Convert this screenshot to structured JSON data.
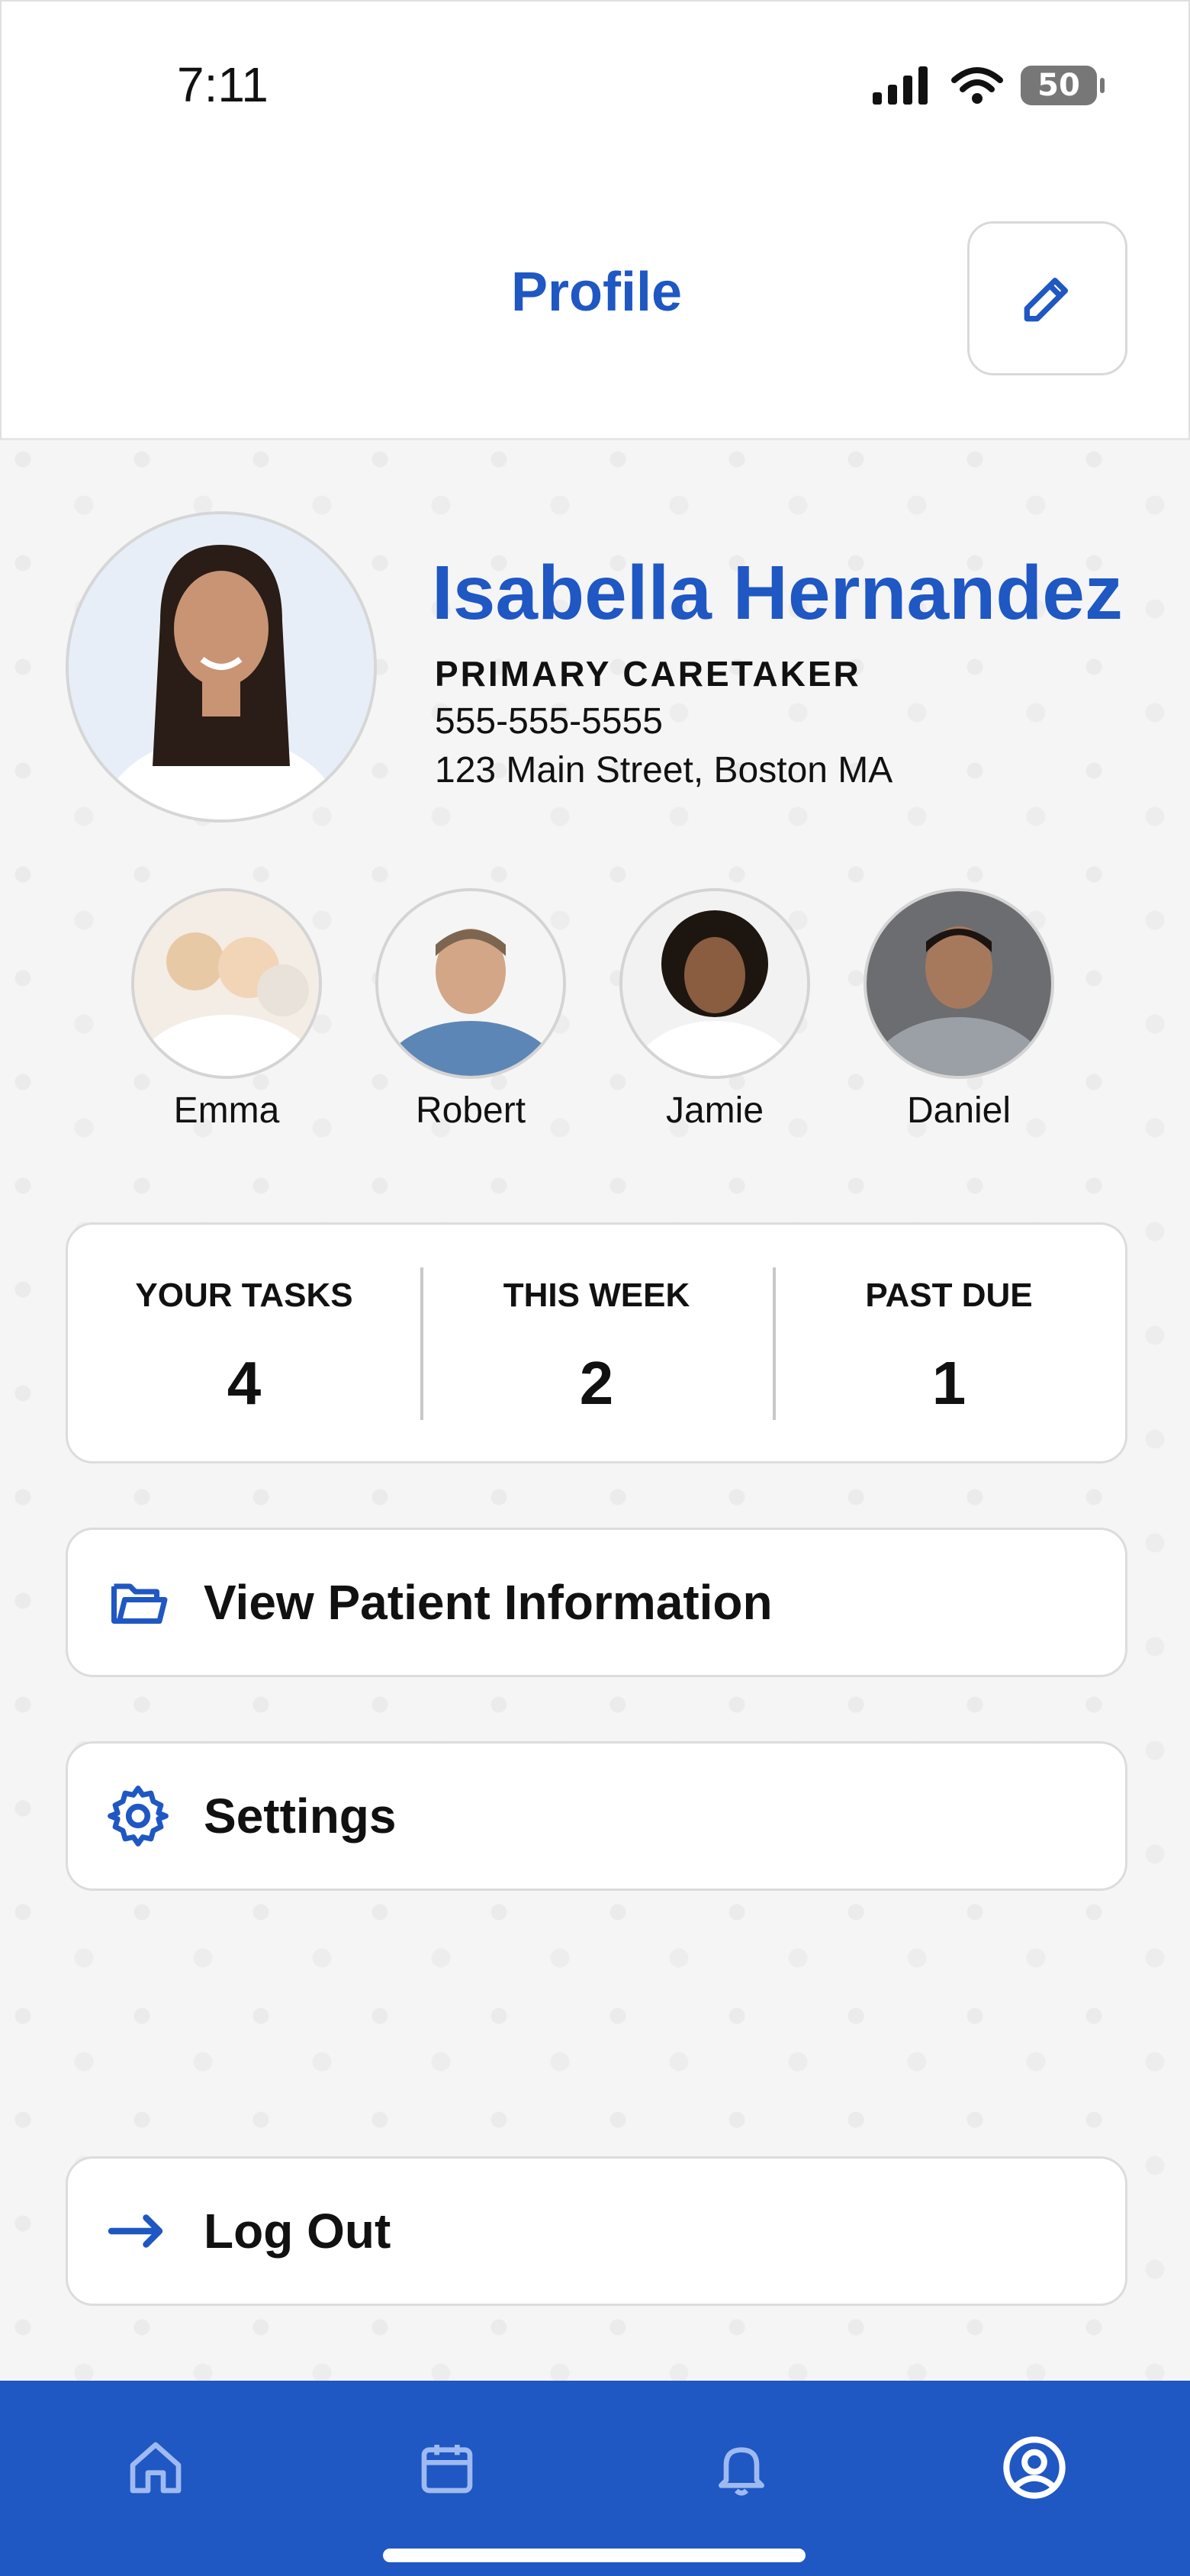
{
  "status_bar": {
    "time": "7:11",
    "battery": "50"
  },
  "header": {
    "title": "Profile"
  },
  "profile": {
    "name": "Isabella Hernandez",
    "role": "PRIMARY CARETAKER",
    "phone": "555-555-5555",
    "address": "123 Main Street, Boston MA"
  },
  "family": [
    {
      "name": "Emma"
    },
    {
      "name": "Robert"
    },
    {
      "name": "Jamie"
    },
    {
      "name": "Daniel"
    }
  ],
  "stats": [
    {
      "label": "YOUR TASKS",
      "value": "4"
    },
    {
      "label": "THIS WEEK",
      "value": "2"
    },
    {
      "label": "PAST DUE",
      "value": "1"
    }
  ],
  "actions": {
    "view_patient": "View Patient Information",
    "settings": "Settings",
    "logout": "Log Out"
  },
  "colors": {
    "accent": "#1f57c3",
    "background": "#f5f5f6"
  },
  "nav": {
    "items": [
      {
        "icon": "home-icon"
      },
      {
        "icon": "calendar-icon"
      },
      {
        "icon": "bell-icon"
      },
      {
        "icon": "profile-icon"
      }
    ]
  }
}
